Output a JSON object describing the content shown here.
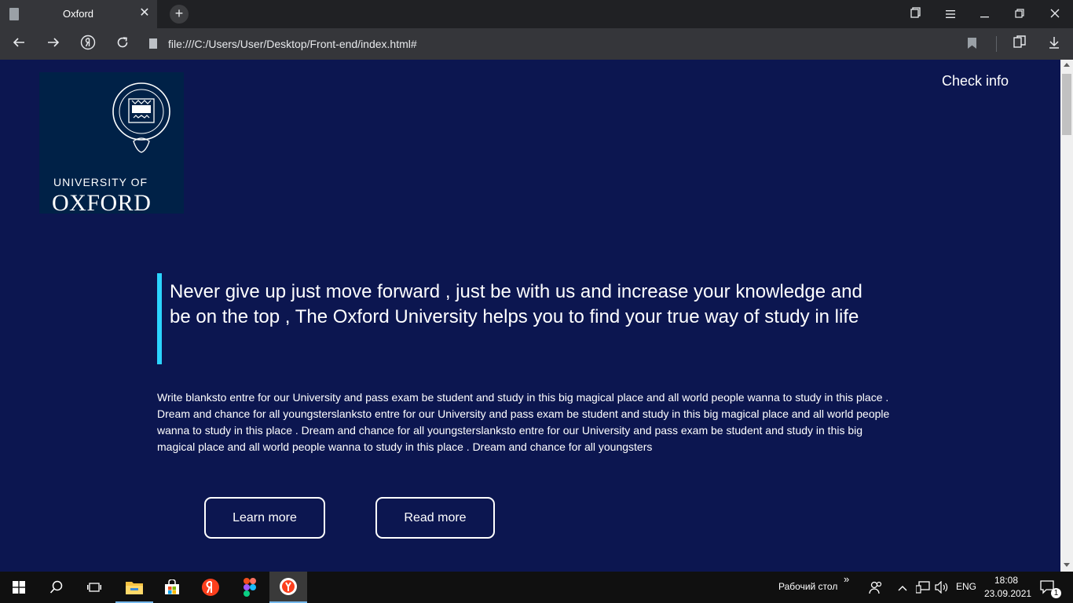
{
  "browser": {
    "tab_title": "Oxford",
    "tab_close": "✕",
    "new_tab": "+",
    "url": "file:///C:/Users/User/Desktop/Front-end/index.html#"
  },
  "page": {
    "logo": {
      "line1": "UNIVERSITY OF",
      "line2": "OXFORD"
    },
    "nav_link": "Check info",
    "headline": "Never give up just move forward , just be with us and increase your knowledge and be on the top , The Oxford University helps you to find your true way of study in life",
    "body": "Write blanksto entre for our University and pass exam be student and study in this big magical place and all world people wanna to study in this place . Dream and chance for all youngsterslanksto entre for our University and pass exam be student and study in this big magical place and all world people wanna to study in this place . Dream and chance for all youngsterslanksto entre for our University and pass exam be student and study in this big magical place and all world people wanna to study in this place . Dream and chance for all youngsters",
    "buttons": {
      "learn": "Learn more",
      "read": "Read more"
    },
    "colors": {
      "background": "#0c1650",
      "accent_bar": "#2bd4ff"
    }
  },
  "taskbar": {
    "desktop_label": "Рабочий стол",
    "lang": "ENG",
    "time": "18:08",
    "date": "23.09.2021",
    "notification_count": "1",
    "chevron": "»"
  }
}
